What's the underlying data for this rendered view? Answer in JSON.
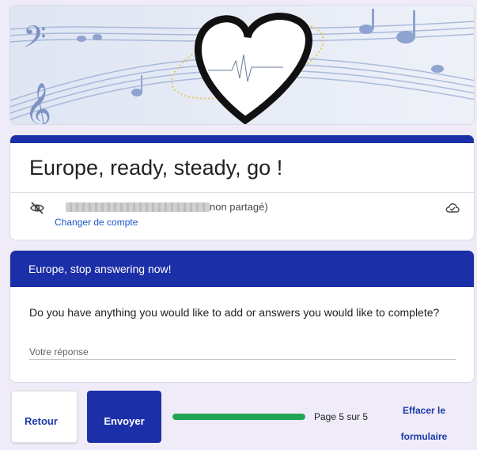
{
  "form": {
    "title": "Europe, ready, steady, go !",
    "account_status": "non partagé)",
    "switch_account": "Changer de compte"
  },
  "section": {
    "header": "Europe, stop answering now!",
    "question": "Do you have anything you would like to add or answers you would like to complete?",
    "answer_placeholder": "Votre réponse",
    "answer_value": ""
  },
  "nav": {
    "back_label": "Retour",
    "submit_label": "Envoyer",
    "progress_percent": 100,
    "page_label": "Page 5 sur 5",
    "clear_label": "Effacer le formulaire"
  },
  "icons": {
    "hidden": "eye-off-icon",
    "cloud": "cloud-done-icon"
  },
  "colors": {
    "accent": "#1b2fa8",
    "progress": "#23a454",
    "link": "#1a56c4"
  }
}
